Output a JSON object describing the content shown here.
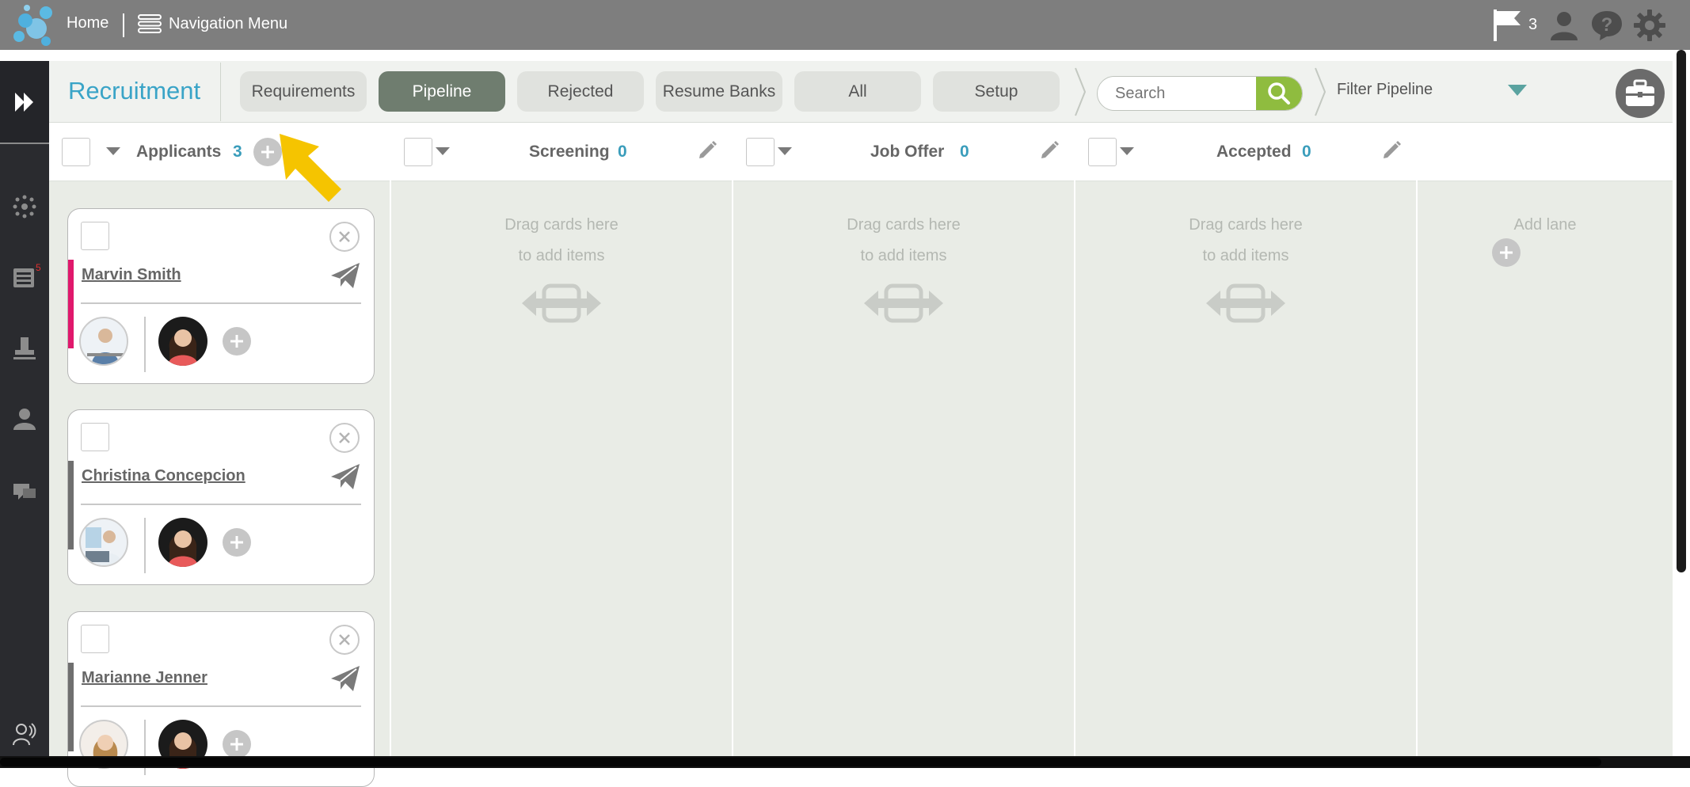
{
  "topbar": {
    "home_label": "Home",
    "nav_menu_label": "Navigation Menu",
    "flag_count": "3"
  },
  "sidebar": {
    "badge_count": "5"
  },
  "header": {
    "app_title": "Recruitment",
    "tabs": [
      {
        "label": "Requirements",
        "active": false
      },
      {
        "label": "Pipeline",
        "active": true
      },
      {
        "label": "Rejected",
        "active": false
      },
      {
        "label": "Resume Banks",
        "active": false
      },
      {
        "label": "All",
        "active": false
      },
      {
        "label": "Setup",
        "active": false
      }
    ],
    "search_placeholder": "Search",
    "filter_label": "Filter Pipeline"
  },
  "lanes": [
    {
      "name": "Applicants",
      "count": "3"
    },
    {
      "name": "Screening",
      "count": "0"
    },
    {
      "name": "Job Offer",
      "count": "0"
    },
    {
      "name": "Accepted",
      "count": "0"
    }
  ],
  "drop_hint": {
    "line1": "Drag cards here",
    "line2": "to add items"
  },
  "add_lane_label": "Add lane",
  "cards": [
    {
      "name": "Marvin Smith",
      "bar_color": "#e0186c"
    },
    {
      "name": "Christina Concepcion",
      "bar_color": "#6f6f6f"
    },
    {
      "name": "Marianne Jenner",
      "bar_color": "#6f6f6f"
    }
  ],
  "colors": {
    "accent": "#3aa4c7",
    "active_tab": "#6f7d6f",
    "search_button": "#8fbc3f",
    "pointer": "#f5c400"
  }
}
